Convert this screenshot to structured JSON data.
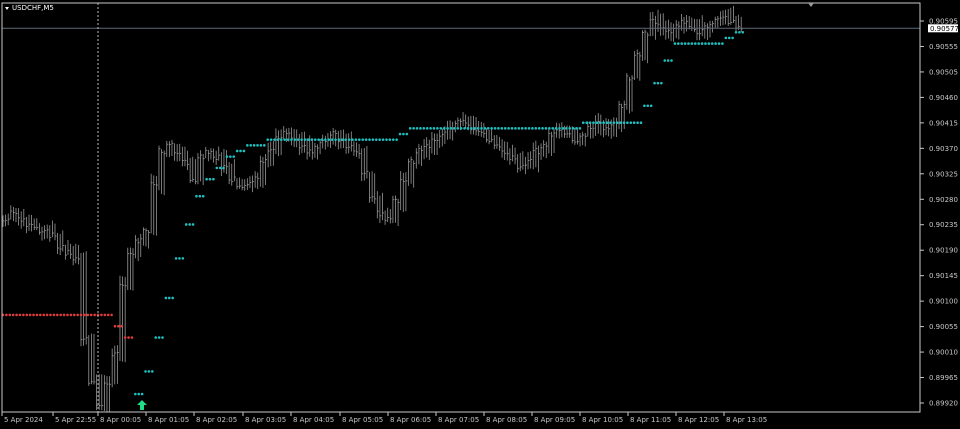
{
  "window": {
    "title": "USDCHF,M5"
  },
  "price_axis": {
    "ticks": [
      "0.90595",
      "0.90555",
      "0.90505",
      "0.90460",
      "0.90415",
      "0.90370",
      "0.90325",
      "0.90280",
      "0.90235",
      "0.90190",
      "0.90145",
      "0.90100",
      "0.90055",
      "0.90010",
      "0.89965",
      "0.89920"
    ],
    "current_price": "0.90577"
  },
  "time_axis": {
    "ticks": [
      "5 Apr 2024",
      "5 Apr 22:55",
      "8 Apr 00:05",
      "8 Apr 01:05",
      "8 Apr 02:05",
      "8 Apr 03:05",
      "8 Apr 04:05",
      "8 Apr 05:05",
      "8 Apr 06:05",
      "8 Apr 07:05",
      "8 Apr 08:05",
      "8 Apr 09:05",
      "8 Apr 10:05",
      "8 Apr 11:05",
      "8 Apr 12:05",
      "8 Apr 13:05"
    ]
  },
  "colors": {
    "background": "#000000",
    "bars": "#9a9a9a",
    "sar_up": "#1fbfbf",
    "sar_down": "#e03c3c",
    "buy_arrow": "#22dd88",
    "axis": "#c8c8c8",
    "price_line": "#5d6a78",
    "period_separator": "#bbbbbb"
  },
  "chart_data": {
    "type": "line",
    "symbol": "USDCHF",
    "timeframe": "M5",
    "ylim": [
      0.899,
      0.9062
    ],
    "current_price": 0.90577,
    "series": [
      {
        "values": [
          0.9024,
          0.9025,
          0.9024,
          0.9023,
          0.9022,
          0.9022,
          0.9021,
          0.9019,
          0.9018,
          0.9017,
          0.9003,
          0.8995,
          0.8991,
          0.8995,
          0.9,
          0.9012,
          0.9018,
          0.902,
          0.9022,
          0.903,
          0.9036,
          0.9037,
          0.9036,
          0.9034,
          0.9031,
          0.9035,
          0.9036,
          0.9035,
          0.9033,
          0.9031,
          0.903,
          0.903,
          0.9031,
          0.9034,
          0.9036,
          0.9038,
          0.9039,
          0.9038,
          0.9037,
          0.9036,
          0.9037,
          0.9038,
          0.9039,
          0.9038,
          0.9037,
          0.9036,
          0.9032,
          0.9028,
          0.9025,
          0.9024,
          0.9027,
          0.9031,
          0.9034,
          0.9036,
          0.9037,
          0.9038,
          0.9039,
          0.904,
          0.9041,
          0.9041,
          0.904,
          0.9039,
          0.9038,
          0.9037,
          0.9036,
          0.9035,
          0.9033,
          0.9034,
          0.9036,
          0.9037,
          0.9039,
          0.904,
          0.9039,
          0.9038,
          0.9039,
          0.904,
          0.9041,
          0.904,
          0.9041,
          0.9044,
          0.9049,
          0.9053,
          0.9057,
          0.9059,
          0.9058,
          0.9057,
          0.9058,
          0.9059,
          0.9058,
          0.9057,
          0.9058,
          0.9059,
          0.906,
          0.9059,
          0.9058
        ]
      },
      {
        "values": [
          0.9007,
          0.9007,
          0.9007,
          0.9007,
          0.9007,
          0.9007,
          0.9007,
          0.9007,
          0.9007,
          0.9007,
          0.9007,
          0.9005,
          0.9003,
          0.8993,
          0.8997,
          0.9003,
          0.901,
          0.9017,
          0.9023,
          0.9028,
          0.9031,
          0.9033,
          0.9035,
          0.9036,
          0.9037,
          0.9037,
          0.9038,
          0.9038,
          0.9038,
          0.9038,
          0.9038,
          0.9038,
          0.9038,
          0.9038,
          0.9038,
          0.9038,
          0.9038,
          0.9038,
          0.9038,
          0.9039,
          0.904,
          0.904,
          0.904,
          0.904,
          0.904,
          0.904,
          0.904,
          0.904,
          0.904,
          0.904,
          0.904,
          0.904,
          0.904,
          0.904,
          0.904,
          0.904,
          0.904,
          0.9041,
          0.9041,
          0.9041,
          0.9041,
          0.9041,
          0.9041,
          0.9044,
          0.9048,
          0.9052,
          0.9055,
          0.9055,
          0.9055,
          0.9055,
          0.9055,
          0.9056,
          0.9057
        ]
      }
    ]
  }
}
